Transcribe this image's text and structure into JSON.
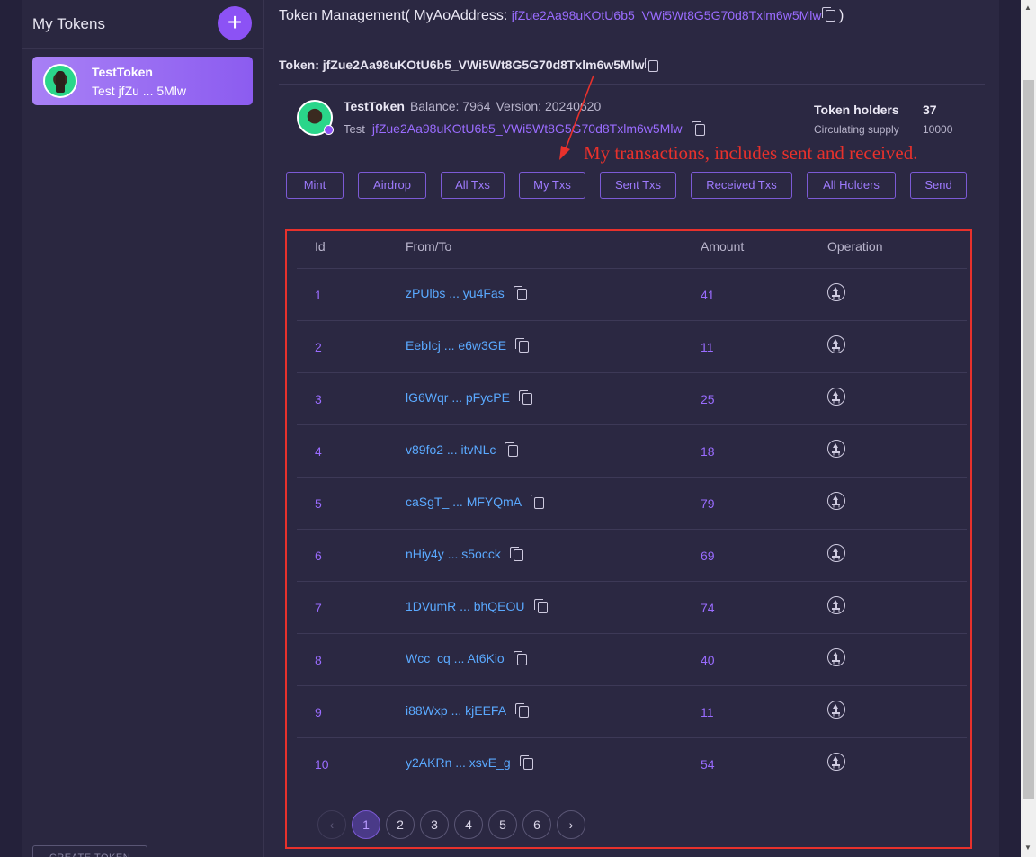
{
  "sidebar": {
    "title": "My Tokens",
    "add_icon": "plus-icon",
    "token_card": {
      "name": "TestToken",
      "sub": "Test jfZu ... 5Mlw"
    },
    "footer_button": "CREATE TOKEN"
  },
  "header": {
    "title_prefix": "Token Management( MyAoAddress:",
    "address": "jfZue2Aa98uKOtU6b5_VWi5Wt8G5G70d8Txlm6w5Mlw",
    "title_suffix": ")",
    "token_line": "Token: jfZue2Aa98uKOtU6b5_VWi5Wt8G5G70d8Txlm6w5Mlw"
  },
  "token_info": {
    "name": "TestToken",
    "balance": "Balance: 7964",
    "version": "Version: 20240620",
    "ticker": "Test",
    "address": "jfZue2Aa98uKOtU6b5_VWi5Wt8G5G70d8Txlm6w5Mlw",
    "holders_label": "Token holders",
    "holders_value": "37",
    "supply_label": "Circulating supply",
    "supply_value": "10000"
  },
  "annotation": "My transactions, includes sent and received.",
  "actions": [
    "Mint",
    "Airdrop",
    "All Txs",
    "My Txs",
    "Sent Txs",
    "Received Txs",
    "All Holders",
    "Send"
  ],
  "table": {
    "headers": [
      "Id",
      "From/To",
      "Amount",
      "Operation"
    ],
    "rows": [
      {
        "id": "1",
        "from": "zPUlbs ... yu4Fas",
        "amount": "41"
      },
      {
        "id": "2",
        "from": "EebIcj ... e6w3GE",
        "amount": "11"
      },
      {
        "id": "3",
        "from": "lG6Wqr ... pFycPE",
        "amount": "25"
      },
      {
        "id": "4",
        "from": "v89fo2 ... itvNLc",
        "amount": "18"
      },
      {
        "id": "5",
        "from": "caSgT_ ... MFYQmA",
        "amount": "79"
      },
      {
        "id": "6",
        "from": "nHiy4y ... s5occk",
        "amount": "69"
      },
      {
        "id": "7",
        "from": "1DVumR ... bhQEOU",
        "amount": "74"
      },
      {
        "id": "8",
        "from": "Wcc_cq ... At6Kio",
        "amount": "40"
      },
      {
        "id": "9",
        "from": "i88Wxp ... kjEEFA",
        "amount": "11"
      },
      {
        "id": "10",
        "from": "y2AKRn ... xsvE_g",
        "amount": "54"
      }
    ]
  },
  "pagination": {
    "pages": [
      "1",
      "2",
      "3",
      "4",
      "5",
      "6"
    ],
    "current": "1",
    "prev": "‹",
    "next": "›"
  },
  "colors": {
    "accent": "#8c52f5",
    "link": "#5aa9ff",
    "annotation": "#e8312c"
  }
}
